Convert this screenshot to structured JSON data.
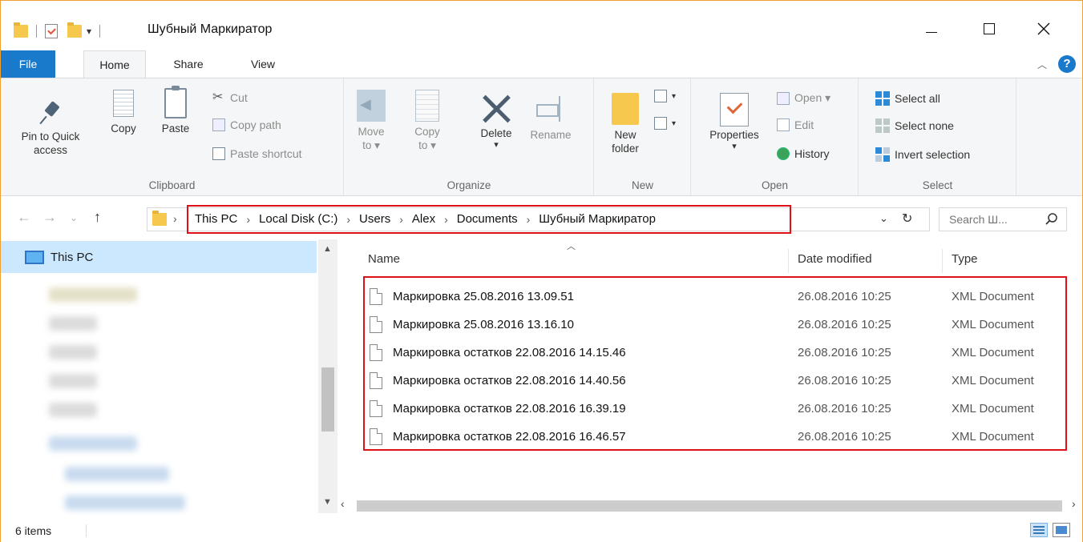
{
  "window": {
    "title": "Шубный Маркиратор"
  },
  "qat": {
    "dropdown_glyph": "▾"
  },
  "ribbon_tabs": [
    "File",
    "Home",
    "Share",
    "View"
  ],
  "ribbon": {
    "clipboard": {
      "label": "Clipboard",
      "pin_line1": "Pin to Quick",
      "pin_line2": "access",
      "copy": "Copy",
      "paste": "Paste",
      "cut": "Cut",
      "copy_path": "Copy path",
      "paste_shortcut": "Paste shortcut"
    },
    "organize": {
      "label": "Organize",
      "move_to_line1": "Move",
      "move_to_line2": "to ▾",
      "copy_to_line1": "Copy",
      "copy_to_line2": "to ▾",
      "delete": "Delete",
      "delete_arrow": "▾",
      "rename": "Rename"
    },
    "new": {
      "label": "New",
      "new_folder_line1": "New",
      "new_folder_line2": "folder"
    },
    "open": {
      "label": "Open",
      "properties": "Properties",
      "properties_arrow": "▾",
      "open": "Open ▾",
      "edit": "Edit",
      "history": "History"
    },
    "select": {
      "label": "Select",
      "select_all": "Select all",
      "select_none": "Select none",
      "invert_selection": "Invert selection"
    }
  },
  "address": {
    "crumbs": [
      "This PC",
      "Local Disk (C:)",
      "Users",
      "Alex",
      "Documents",
      "Шубный Маркиратор"
    ],
    "separator": "›",
    "lead_separator": "›"
  },
  "search": {
    "placeholder": "Search Ш..."
  },
  "nav_pane": {
    "this_pc": "This PC"
  },
  "columns": {
    "name": "Name",
    "date": "Date modified",
    "type": "Type"
  },
  "files": [
    {
      "name": "Маркировка 25.08.2016 13.09.51",
      "date": "26.08.2016 10:25",
      "type": "XML Document"
    },
    {
      "name": "Маркировка 25.08.2016 13.16.10",
      "date": "26.08.2016 10:25",
      "type": "XML Document"
    },
    {
      "name": "Маркировка остатков 22.08.2016 14.15.46",
      "date": "26.08.2016 10:25",
      "type": "XML Document"
    },
    {
      "name": "Маркировка остатков 22.08.2016 14.40.56",
      "date": "26.08.2016 10:25",
      "type": "XML Document"
    },
    {
      "name": "Маркировка остатков 22.08.2016 16.39.19",
      "date": "26.08.2016 10:25",
      "type": "XML Document"
    },
    {
      "name": "Маркировка остатков 22.08.2016 16.46.57",
      "date": "26.08.2016 10:25",
      "type": "XML Document"
    }
  ],
  "status": {
    "item_count": "6 items"
  },
  "colors": {
    "accent": "#1979ca",
    "highlight_box": "#e0101a",
    "selection": "#cce8ff"
  }
}
